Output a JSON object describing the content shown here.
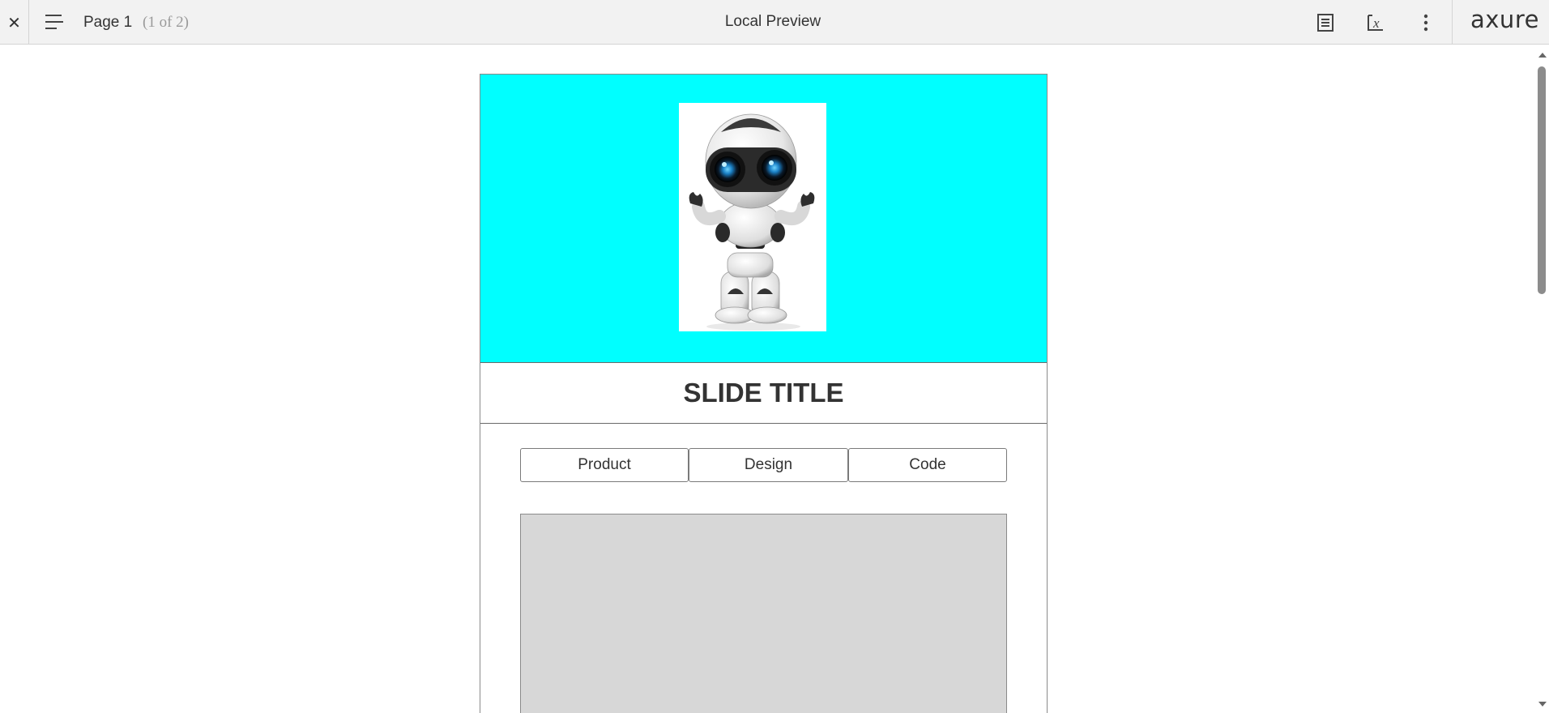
{
  "toolbar": {
    "close_icon": "close-icon",
    "menu_icon": "sitemap-menu-icon",
    "page_label": "Page 1",
    "page_count": "(1 of 2)",
    "title": "Local Preview",
    "notes_icon": "notes-icon",
    "variables_icon": "variables-icon",
    "more_icon": "more-options-icon",
    "brand": "axure"
  },
  "slide": {
    "hero_color": "#00ffff",
    "hero_image": "robot-image",
    "title": "SLIDE TITLE",
    "tabs": [
      {
        "label": "Product"
      },
      {
        "label": "Design"
      },
      {
        "label": "Code"
      }
    ],
    "content_panel_color": "#d7d7d7"
  }
}
